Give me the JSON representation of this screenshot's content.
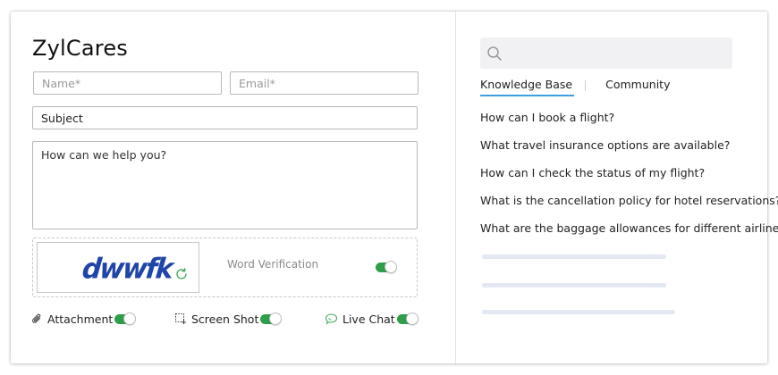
{
  "brand": {
    "title": "ZylCares"
  },
  "form": {
    "name_placeholder": "Name*",
    "email_placeholder": "Email*",
    "subject_value": "Subject",
    "message_placeholder": "How can we help you?"
  },
  "captcha": {
    "text": "dwwfk",
    "label": "Word Verification",
    "enabled": true
  },
  "options": [
    {
      "label": "Attachment",
      "icon": "paperclip-icon",
      "enabled": true
    },
    {
      "label": "Screen Shot",
      "icon": "screenshot-icon",
      "enabled": true
    },
    {
      "label": "Live Chat",
      "icon": "chat-bubble-icon",
      "enabled": true
    }
  ],
  "help": {
    "search_placeholder": "",
    "tabs": [
      {
        "label": "Knowledge Base",
        "active": true
      },
      {
        "label": "Community",
        "active": false
      }
    ],
    "faqs": [
      "How can I book a flight?",
      "What travel insurance options are available?",
      "How can I check the status of my flight?",
      "What is the cancellation policy for hotel reservations?",
      "What are the baggage allowances for different airlines?"
    ]
  },
  "colors": {
    "accent": "#3b9fe2",
    "toggle_on": "#2e9e4a",
    "captcha_text": "#1f45a8",
    "skeleton": "#e4e8f3"
  }
}
